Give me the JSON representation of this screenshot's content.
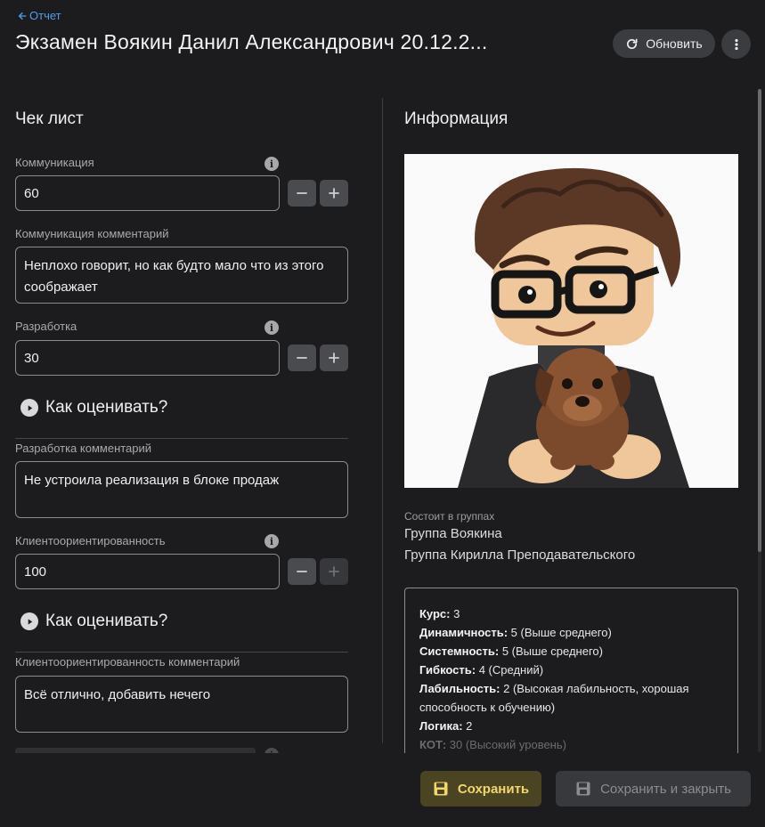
{
  "header": {
    "back_label": "Отчет",
    "title": "Экзамен Воякин Данил Александрович 20.12.2...",
    "refresh_label": "Обновить"
  },
  "checklist": {
    "title": "Чек лист",
    "communication": {
      "label": "Коммуникация",
      "value": "60"
    },
    "communication_comment": {
      "label": "Коммуникация комментарий",
      "value": "Неплохо говорит, но как будто мало что из этого соображает"
    },
    "development": {
      "label": "Разработка",
      "value": "30"
    },
    "how_to_rate_1": "Как оценивать?",
    "development_comment": {
      "label": "Разработка комментарий",
      "value": "Не устроила реализация в блоке продаж"
    },
    "client_orientation": {
      "label": "Клиентоориентированность",
      "value": "100"
    },
    "how_to_rate_2": "Как оценивать?",
    "client_orientation_comment": {
      "label": "Клиентоориентированность комментарий",
      "value": "Всё отлично, добавить нечего"
    }
  },
  "info": {
    "title": "Информация",
    "groups_label": "Состоит в группах",
    "groups": [
      "Группа Воякина",
      "Группа Кирилла Преподавательского"
    ],
    "details": [
      {
        "key": "Курс:",
        "value": " 3"
      },
      {
        "key": "Динамичность:",
        "value": " 5 (Выше среднего)"
      },
      {
        "key": "Системность:",
        "value": " 5 (Выше среднего)"
      },
      {
        "key": "Гибкость:",
        "value": " 4 (Средний)"
      },
      {
        "key": "Лабильность:",
        "value": " 2 (Высокая лабильность, хорошая способность к обучению)"
      },
      {
        "key": "Логика:",
        "value": " 2"
      },
      {
        "key": "КОТ:",
        "value": " 30 (Высокий уровень)"
      }
    ]
  },
  "footer": {
    "save_label": "Сохранить",
    "save_close_label": "Сохранить и закрыть"
  },
  "colors": {
    "accent_link": "#4f9cf0",
    "save_text": "#f2d76b",
    "background": "#1c1c1e"
  }
}
